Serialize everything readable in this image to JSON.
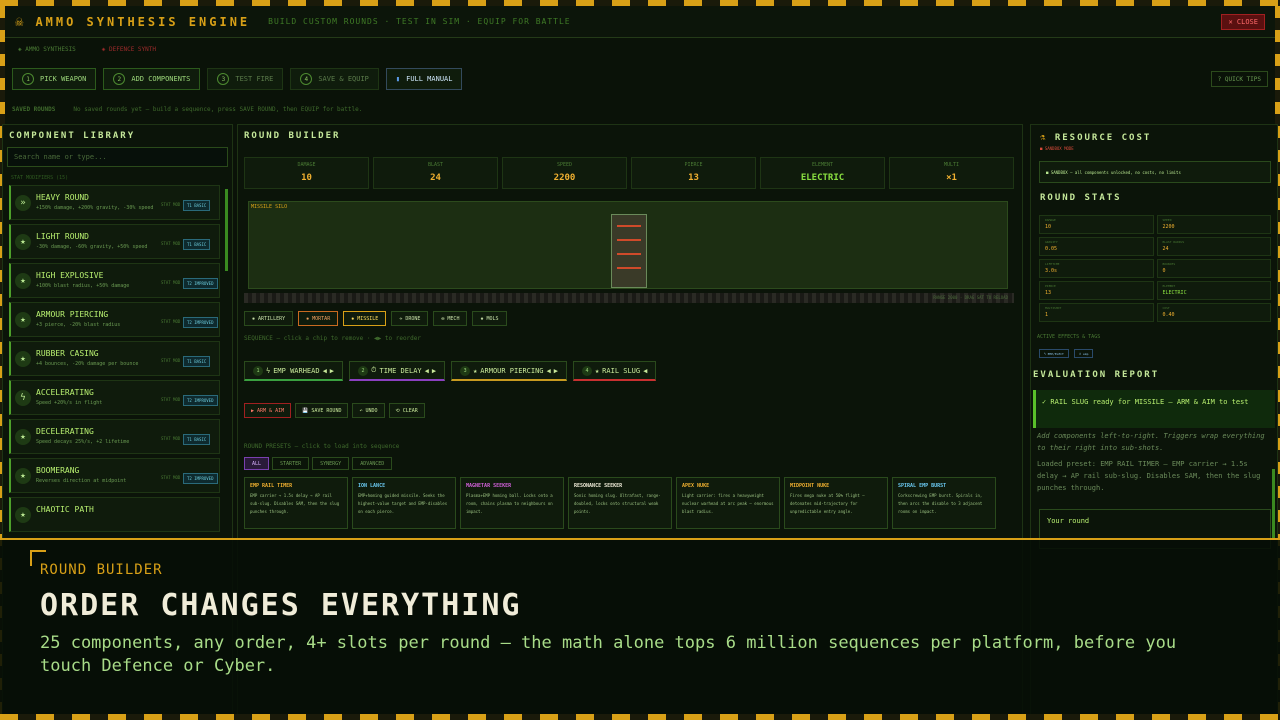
{
  "header": {
    "title": "AMMO SYNTHESIS ENGINE",
    "subtitle": "BUILD CUSTOM ROUNDS · TEST IN SIM · EQUIP FOR BATTLE",
    "close_label": "✕ CLOSE"
  },
  "mode_tabs": [
    "◈ AMMO SYNTHESIS",
    "◈ DEFENCE SYNTH"
  ],
  "steps": [
    {
      "num": "1",
      "label": "PICK WEAPON"
    },
    {
      "num": "2",
      "label": "ADD COMPONENTS"
    },
    {
      "num": "3",
      "label": "TEST FIRE"
    },
    {
      "num": "4",
      "label": "SAVE & EQUIP"
    }
  ],
  "manual_label": "FULL MANUAL",
  "tips_label": "? QUICK TIPS",
  "saved": {
    "label": "SAVED ROUNDS",
    "text": "No saved rounds yet — build a sequence, press SAVE ROUND, then EQUIP for battle."
  },
  "library": {
    "title": "COMPONENT LIBRARY",
    "search_placeholder": "Search name or type...",
    "section": "STAT MODIFIERS (15)",
    "items": [
      {
        "icon": "»",
        "name": "HEAVY ROUND",
        "desc": "+150% damage, +200% gravity, -30% speed",
        "mod": "STAT MOD",
        "badge": "T1 BASIC"
      },
      {
        "icon": "★",
        "name": "LIGHT ROUND",
        "desc": "-30% damage, -60% gravity, +50% speed",
        "mod": "STAT MOD",
        "badge": "T1 BASIC"
      },
      {
        "icon": "★",
        "name": "HIGH EXPLOSIVE",
        "desc": "+100% blast radius, +50% damage",
        "mod": "STAT MOD",
        "badge": "T2 IMPROVED"
      },
      {
        "icon": "★",
        "name": "ARMOUR PIERCING",
        "desc": "+3 pierce, -20% blast radius",
        "mod": "STAT MOD",
        "badge": "T2 IMPROVED"
      },
      {
        "icon": "★",
        "name": "RUBBER CASING",
        "desc": "+4 bounces, -20% damage per bounce",
        "mod": "STAT MOD",
        "badge": "T1 BASIC"
      },
      {
        "icon": "ϟ",
        "name": "ACCELERATING",
        "desc": "Speed +20%/s in flight",
        "mod": "STAT MOD",
        "badge": "T2 IMPROVED"
      },
      {
        "icon": "★",
        "name": "DECELERATING",
        "desc": "Speed decays 25%/s, +2 lifetime",
        "mod": "STAT MOD",
        "badge": "T1 BASIC"
      },
      {
        "icon": "★",
        "name": "BOOMERANG",
        "desc": "Reverses direction at midpoint",
        "mod": "STAT MOD",
        "badge": "T2 IMPROVED"
      },
      {
        "icon": "★",
        "name": "CHAOTIC PATH",
        "desc": "",
        "mod": "",
        "badge": ""
      }
    ]
  },
  "builder": {
    "title": "ROUND BUILDER",
    "stats": [
      {
        "label": "DAMAGE",
        "value": "10"
      },
      {
        "label": "BLAST",
        "value": "24"
      },
      {
        "label": "SPEED",
        "value": "2200"
      },
      {
        "label": "PIERCE",
        "value": "13"
      },
      {
        "label": "ELEMENT",
        "value": "ELECTRIC"
      },
      {
        "label": "MULTI",
        "value": "×1"
      }
    ],
    "silo_label": "MISSILE SILO",
    "ground_label": "RANGE 2000 · DRAG SAT TO RELOAD",
    "platforms": [
      "✸ ARTILLERY",
      "✸ MORTAR",
      "✸ MISSILE",
      "✈ DRONE",
      "✠ MECH",
      "✸ MOLS"
    ],
    "seq_hint": "SEQUENCE — click a chip to remove · ◀▶ to reorder",
    "sequence": [
      {
        "num": "1",
        "name": "EMP WARHEAD",
        "color": "#3aa040"
      },
      {
        "num": "2",
        "name": "TIME DELAY",
        "color": "#8a40c0"
      },
      {
        "num": "3",
        "name": "ARMOUR PIERCING",
        "color": "#c89a20"
      },
      {
        "num": "4",
        "name": "RAIL SLUG",
        "color": "#c83030"
      }
    ],
    "actions": [
      "▶ ARM & AIM",
      "💾 SAVE ROUND",
      "↶ UNDO",
      "⟲ CLEAR"
    ],
    "presets_hint": "ROUND PRESETS — click to load into sequence",
    "preset_tabs": [
      "ALL",
      "STARTER",
      "SYNERGY",
      "ADVANCED"
    ],
    "presets": [
      {
        "name": "EMP RAIL TIMER",
        "desc": "EMP carrier → 1.5s delay → AP rail sub-slug. Disables SAM, then the slug punches through.",
        "color": "#f0b030"
      },
      {
        "name": "ION LANCE",
        "desc": "EMP+homing guided missile. Seeks the highest-value target and EMP-disables on each pierce.",
        "color": "#6ac8f0"
      },
      {
        "name": "MAGNETAR SEEKER",
        "desc": "Plasma+EMP homing ball. Locks onto a room, chains plasma to neighbours on impact.",
        "color": "#d060d8"
      },
      {
        "name": "RESONANCE SEEKER",
        "desc": "Sonic homing slug. Ultrafast, range-doubled, locks onto structural weak points.",
        "color": "#f0ecd8"
      },
      {
        "name": "APEX NUKE",
        "desc": "Light carrier: fires a heavyweight nuclear warhead at arc peak — enormous blast radius.",
        "color": "#f0b030"
      },
      {
        "name": "MIDPOINT NUKE",
        "desc": "Fires mega nuke at 50% flight — detonates mid-trajectory for unpredictable entry angle.",
        "color": "#f0b030"
      },
      {
        "name": "SPIRAL EMP BURST",
        "desc": "Corkscrewing EMP burst. Spirals in, then arcs the disable to 3 adjacent rooms on impact.",
        "color": "#6ac8f0"
      }
    ]
  },
  "right": {
    "cost_title": "RESOURCE COST",
    "cost_sub": "■ SANDBOX MODE",
    "sandbox_text": "■ SANDBOX — all components unlocked, no costs, no limits",
    "stats_title": "ROUND STATS",
    "stats": [
      {
        "label": "DAMAGE",
        "value": "10"
      },
      {
        "label": "SPEED",
        "value": "2200"
      },
      {
        "label": "GRAVITY",
        "value": "0.05"
      },
      {
        "label": "BLAST RADIUS",
        "value": "24"
      },
      {
        "label": "LIFETIME",
        "value": "3.0s"
      },
      {
        "label": "BOUNCES",
        "value": "0"
      },
      {
        "label": "PIERCE",
        "value": "13"
      },
      {
        "label": "ELEMENT",
        "value": "ELECTRIC"
      },
      {
        "label": "MULTISHOT",
        "value": "1"
      },
      {
        "label": "COST",
        "value": "0.40"
      }
    ],
    "tags_title": "ACTIVE EFFECTS & TAGS",
    "tags": [
      "ϟ EMP/ELECT",
      "⏱ emp"
    ],
    "eval_title": "EVALUATION REPORT",
    "eval_text": "✓ RAIL SLUG ready for MISSILE — ARM & AIM to test",
    "eval_note": "Add components left-to-right. Triggers wrap everything to their right into sub-shots.",
    "eval_loaded": "Loaded preset: EMP RAIL TIMER — EMP carrier → 1.5s delay → AP rail sub-slug. Disables SAM, then the slug punches through.",
    "your_round": "Your round"
  },
  "overlay": {
    "kicker": "ROUND BUILDER",
    "title": "ORDER CHANGES EVERYTHING",
    "body": "25 components, any order, 4+ slots per round — the math alone tops 6 million sequences per platform, before you touch Defence or Cyber."
  }
}
